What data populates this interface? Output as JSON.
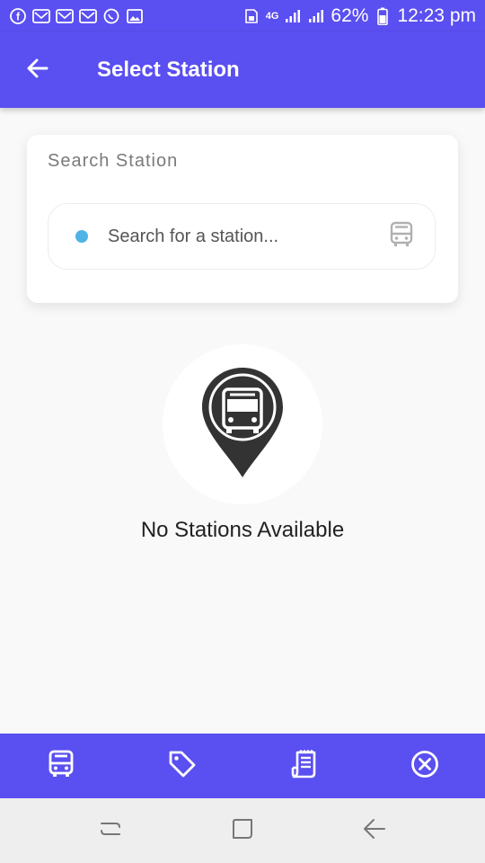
{
  "status_bar": {
    "battery": "62%",
    "time": "12:23 pm",
    "network": "4G",
    "left_icons": [
      "facebook-icon",
      "mail-icon",
      "mail-icon",
      "mail-icon",
      "whatsapp-icon",
      "image-icon"
    ],
    "right_icons": [
      "sim-icon",
      "network-4g-icon",
      "signal-icon",
      "signal-icon",
      "battery-icon"
    ]
  },
  "app_bar": {
    "title": "Select Station",
    "back_icon": "arrow-left-icon"
  },
  "search_card": {
    "title": "Search Station",
    "input_placeholder": "Search for a station...",
    "input_value": "",
    "dot_color": "#4fb3e6",
    "trailing_icon": "bus-icon"
  },
  "empty_state": {
    "icon": "bus-location-pin-icon",
    "message": "No Stations Available"
  },
  "bottom_bar": {
    "items": [
      {
        "icon": "bus-icon"
      },
      {
        "icon": "tag-icon"
      },
      {
        "icon": "receipt-icon"
      },
      {
        "icon": "close-circle-icon"
      }
    ]
  },
  "nav_bar": {
    "items": [
      "recents-icon",
      "home-icon",
      "back-icon"
    ]
  },
  "colors": {
    "primary": "#5a4ff0",
    "background": "#f9f9f9",
    "card": "#ffffff",
    "accent_dot": "#4fb3e6"
  }
}
